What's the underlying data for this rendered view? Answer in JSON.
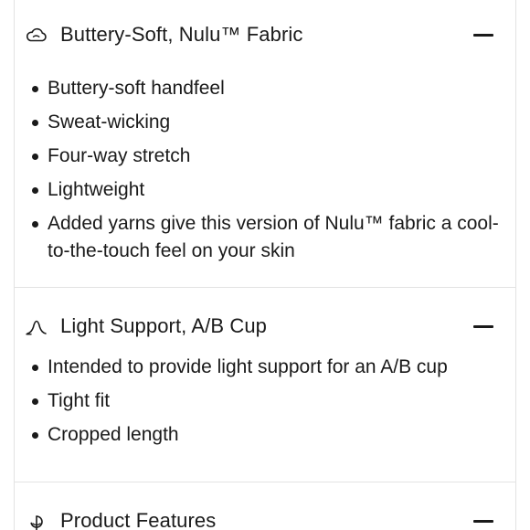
{
  "sections": [
    {
      "icon": "cloud-icon",
      "title": "Buttery-Soft, Nulu™ Fabric",
      "items": [
        "Buttery-soft handfeel",
        "Sweat-wicking",
        "Four-way stretch",
        "Lightweight",
        "Added yarns give this version of Nulu™ fabric a cool-to-the-touch feel on your skin"
      ]
    },
    {
      "icon": "light-support-icon",
      "title": "Light Support, A/B Cup",
      "items": [
        "Intended to provide light support for an A/B cup",
        "Tight fit",
        "Cropped length"
      ]
    },
    {
      "icon": "product-features-icon",
      "title": "Product Features",
      "items": []
    }
  ]
}
